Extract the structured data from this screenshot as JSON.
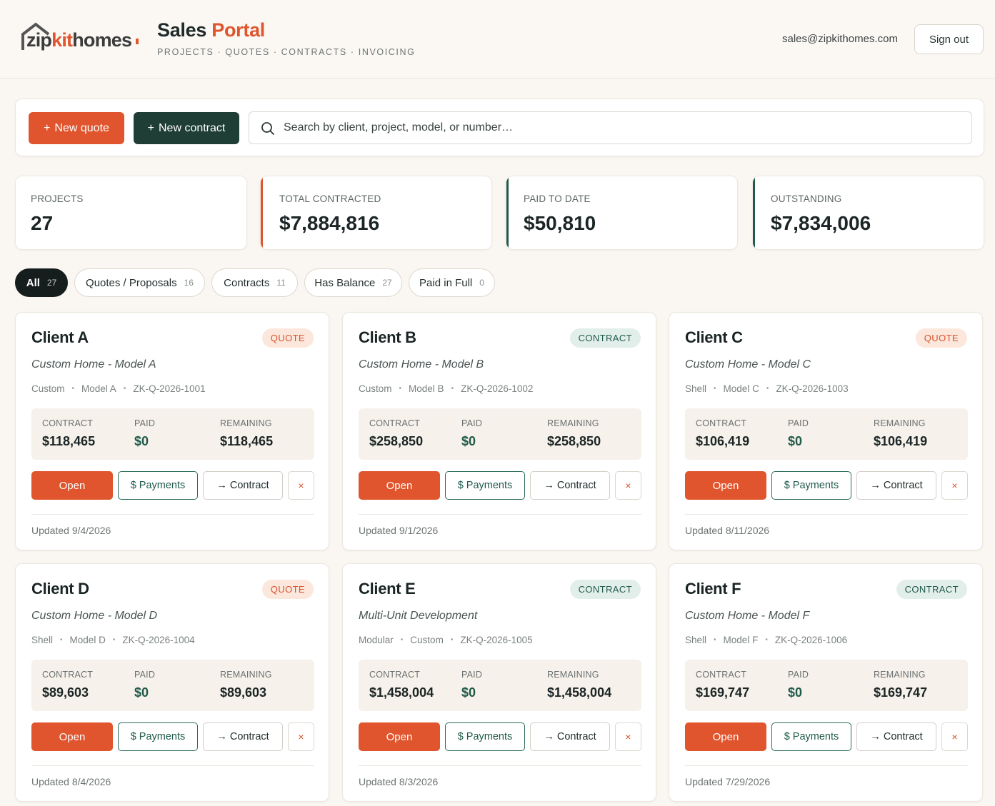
{
  "header": {
    "logo_prefix": "zip",
    "logo_kit": "kit",
    "logo_suffix": "homes",
    "title_main": "Sales",
    "title_accent": "Portal",
    "subtitle": "PROJECTS · QUOTES · CONTRACTS · INVOICING",
    "user_email": "sales@zipkithomes.com",
    "signout_label": "Sign out"
  },
  "colors": {
    "accent": "#e0552d",
    "dark_green": "#1f3e36",
    "teal": "#1f5a4b",
    "background": "#faf6f1"
  },
  "toolbar": {
    "new_quote_icon": "+",
    "new_quote_label": "New quote",
    "new_contract_icon": "+",
    "new_contract_label": "New contract",
    "search_placeholder": "Search by client, project, model, or number…",
    "search_value": ""
  },
  "stats": [
    {
      "label": "PROJECTS",
      "value": "27"
    },
    {
      "label": "TOTAL CONTRACTED",
      "value": "$7,884,816"
    },
    {
      "label": "PAID TO DATE",
      "value": "$50,810"
    },
    {
      "label": "OUTSTANDING",
      "value": "$7,834,006"
    }
  ],
  "filters": [
    {
      "label": "All",
      "count": "27",
      "active": true
    },
    {
      "label": "Quotes / Proposals",
      "count": "16"
    },
    {
      "label": "Contracts",
      "count": "11"
    },
    {
      "label": "Has Balance",
      "count": "27"
    },
    {
      "label": "Paid in Full",
      "count": "0"
    }
  ],
  "card_labels": {
    "contract": "CONTRACT",
    "paid": "PAID",
    "remaining": "REMAINING",
    "open": "Open",
    "payments": "$ Payments",
    "to_contract": "→ Contract",
    "delete": "×"
  },
  "cards": [
    {
      "client": "Client A",
      "status": "QUOTE",
      "project": "Custom Home - Model A",
      "meta": [
        "Custom",
        "Model A",
        "ZK-Q-2026-1001"
      ],
      "contract": "$118,465",
      "paid": "$0",
      "remaining": "$118,465",
      "updated": "Updated 9/4/2026"
    },
    {
      "client": "Client B",
      "status": "CONTRACT",
      "project": "Custom Home - Model B",
      "meta": [
        "Custom",
        "Model B",
        "ZK-Q-2026-1002"
      ],
      "contract": "$258,850",
      "paid": "$0",
      "remaining": "$258,850",
      "updated": "Updated 9/1/2026"
    },
    {
      "client": "Client C",
      "status": "QUOTE",
      "project": "Custom Home - Model C",
      "meta": [
        "Shell",
        "Model C",
        "ZK-Q-2026-1003"
      ],
      "contract": "$106,419",
      "paid": "$0",
      "remaining": "$106,419",
      "updated": "Updated 8/11/2026"
    },
    {
      "client": "Client D",
      "status": "QUOTE",
      "project": "Custom Home - Model D",
      "meta": [
        "Shell",
        "Model D",
        "ZK-Q-2026-1004"
      ],
      "contract": "$89,603",
      "paid": "$0",
      "remaining": "$89,603",
      "updated": "Updated 8/4/2026"
    },
    {
      "client": "Client E",
      "status": "CONTRACT",
      "project": "Multi-Unit Development",
      "meta": [
        "Modular",
        "Custom",
        "ZK-Q-2026-1005"
      ],
      "contract": "$1,458,004",
      "paid": "$0",
      "remaining": "$1,458,004",
      "updated": "Updated 8/3/2026"
    },
    {
      "client": "Client F",
      "status": "CONTRACT",
      "project": "Custom Home - Model F",
      "meta": [
        "Shell",
        "Model F",
        "ZK-Q-2026-1006"
      ],
      "contract": "$169,747",
      "paid": "$0",
      "remaining": "$169,747",
      "updated": "Updated 7/29/2026"
    }
  ]
}
